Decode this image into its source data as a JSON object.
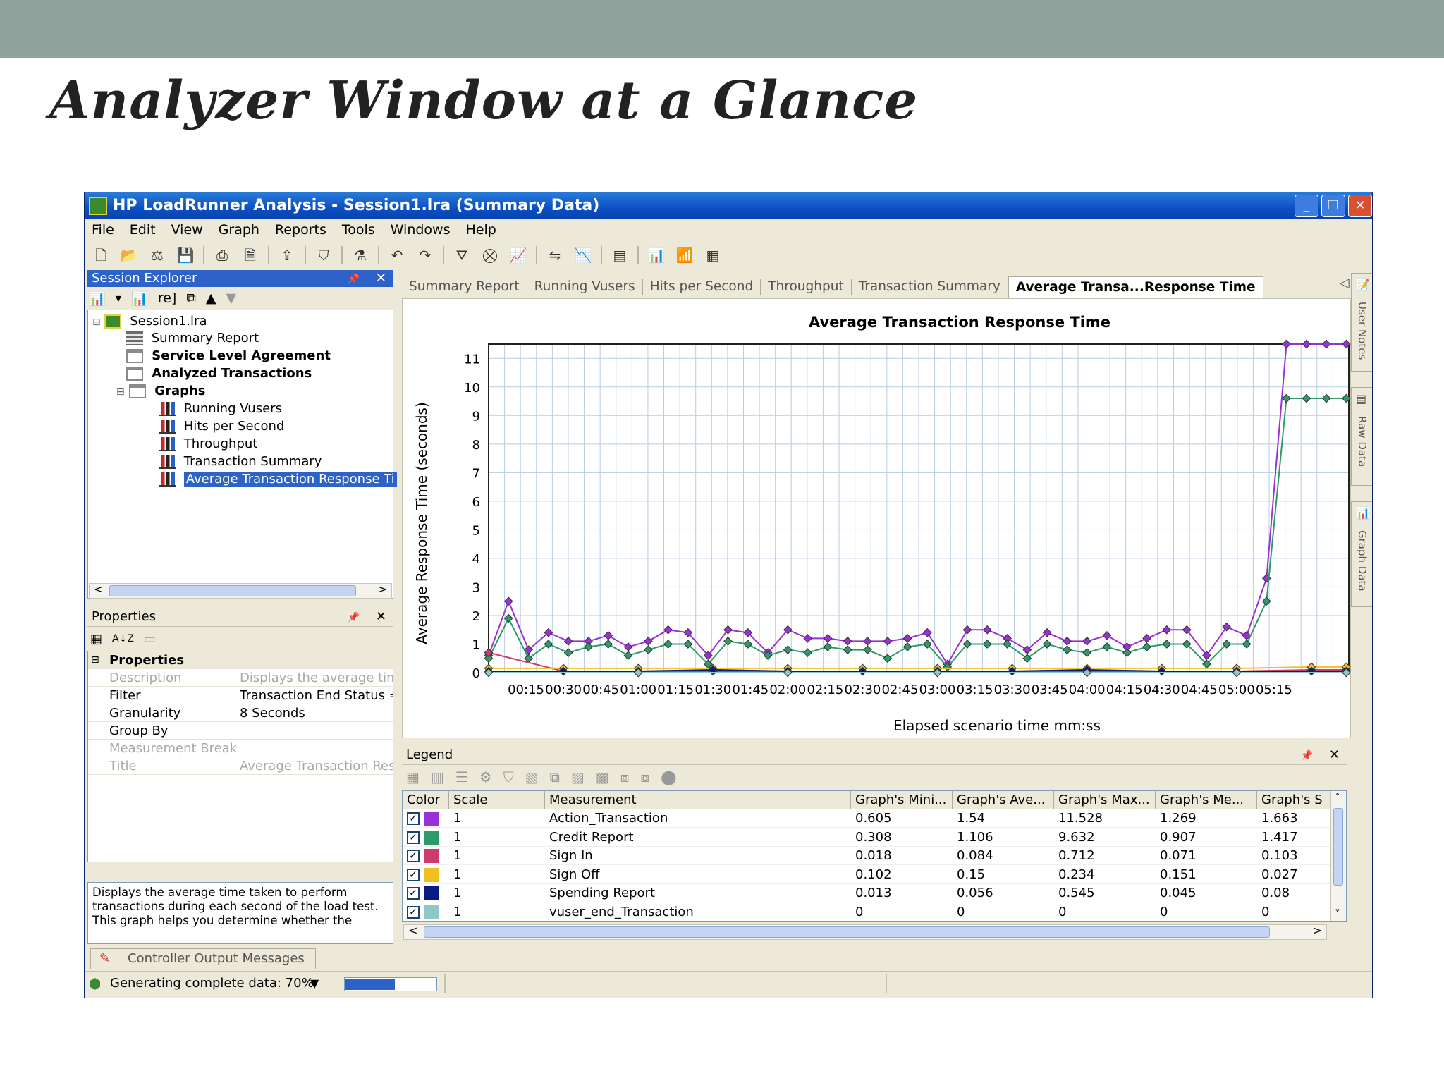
{
  "slide": {
    "title": "Analyzer Window at a Glance"
  },
  "window": {
    "title": "HP LoadRunner Analysis - Session1.lra (Summary Data)",
    "controls": {
      "minimize": "_",
      "restore": "❐",
      "close": "✕"
    }
  },
  "menu": [
    "File",
    "Edit",
    "View",
    "Graph",
    "Reports",
    "Tools",
    "Windows",
    "Help"
  ],
  "session_explorer": {
    "title": "Session Explorer",
    "toolbar_text": "re]",
    "tree": [
      {
        "label": "Session1.lra",
        "icon": "session-icon",
        "bold": false
      },
      {
        "label": "Summary Report",
        "icon": "report-icon",
        "bold": false
      },
      {
        "label": "Service Level Agreement",
        "icon": "folder-icon",
        "bold": true
      },
      {
        "label": "Analyzed Transactions",
        "icon": "folder-icon",
        "bold": true
      },
      {
        "label": "Graphs",
        "icon": "folder-icon",
        "bold": true
      },
      {
        "label": "Running Vusers",
        "icon": "graph-icon",
        "bold": false
      },
      {
        "label": "Hits per Second",
        "icon": "graph-icon",
        "bold": false
      },
      {
        "label": "Throughput",
        "icon": "graph-icon",
        "bold": false
      },
      {
        "label": "Transaction Summary",
        "icon": "graph-icon",
        "bold": false
      },
      {
        "label": "Average Transaction Response Ti",
        "icon": "graph-icon",
        "bold": false,
        "selected": true
      }
    ]
  },
  "properties": {
    "title": "Properties",
    "section": "Properties",
    "rows": [
      {
        "key": "Description",
        "value": "Displays the average time t",
        "dim": true
      },
      {
        "key": "Filter",
        "value": "Transaction End Status = (",
        "dim": false
      },
      {
        "key": "Granularity",
        "value": "8 Seconds",
        "dim": false
      },
      {
        "key": "Group By",
        "value": "",
        "dim": false
      },
      {
        "key": "Measurement Break",
        "value": "",
        "dim": true
      },
      {
        "key": "Title",
        "value": "Average Transaction Resp",
        "dim": true
      }
    ],
    "description_text": "Displays the average time taken to perform transactions during each second of the load test. This graph helps you determine whether the"
  },
  "tabs": [
    {
      "label": "Summary Report",
      "active": false
    },
    {
      "label": "Running Vusers",
      "active": false
    },
    {
      "label": "Hits per Second",
      "active": false
    },
    {
      "label": "Throughput",
      "active": false
    },
    {
      "label": "Transaction Summary",
      "active": false
    },
    {
      "label": "Average Transa...Response Time",
      "active": true
    }
  ],
  "right_tabs": [
    "User Notes",
    "Raw Data",
    "Graph Data"
  ],
  "chart_data": {
    "type": "line",
    "title": "Average Transaction Response Time",
    "xlabel": "Elapsed scenario time mm:ss",
    "ylabel": "Average Response Time (seconds)",
    "x_ticks": [
      "00:15",
      "00:30",
      "00:45",
      "01:00",
      "01:15",
      "01:30",
      "01:45",
      "02:00",
      "02:15",
      "02:30",
      "02:45",
      "03:00",
      "03:15",
      "03:30",
      "03:45",
      "04:00",
      "04:15",
      "04:30",
      "04:45",
      "05:00",
      "05:15"
    ],
    "y_ticks": [
      0,
      1,
      2,
      3,
      4,
      5,
      6,
      7,
      8,
      9,
      10,
      11
    ],
    "ylim": [
      0,
      11.5
    ],
    "xlim": [
      0,
      5.75
    ],
    "grid": true,
    "series": [
      {
        "name": "Action_Transaction",
        "color": "#9b30d8",
        "x": [
          0.0,
          0.133,
          0.267,
          0.4,
          0.533,
          0.667,
          0.8,
          0.933,
          1.067,
          1.2,
          1.333,
          1.467,
          1.6,
          1.733,
          1.867,
          2.0,
          2.133,
          2.267,
          2.4,
          2.533,
          2.667,
          2.8,
          2.933,
          3.067,
          3.2,
          3.333,
          3.467,
          3.6,
          3.733,
          3.867,
          4.0,
          4.133,
          4.267,
          4.4,
          4.533,
          4.667,
          4.8,
          4.933,
          5.067,
          5.2,
          5.333,
          5.467,
          5.6,
          5.733
        ],
        "y": [
          0.6,
          2.5,
          0.8,
          1.4,
          1.1,
          1.1,
          1.3,
          0.9,
          1.1,
          1.5,
          1.4,
          0.6,
          1.5,
          1.4,
          0.7,
          1.5,
          1.2,
          1.2,
          1.1,
          1.1,
          1.1,
          1.2,
          1.4,
          0.3,
          1.5,
          1.5,
          1.2,
          0.8,
          1.4,
          1.1,
          1.1,
          1.3,
          0.9,
          1.2,
          1.5,
          1.5,
          0.6,
          1.6,
          1.3,
          3.3,
          11.5,
          11.5,
          11.5,
          11.5
        ]
      },
      {
        "name": "Credit Report",
        "color": "#2e9a6a",
        "x": [
          0.0,
          0.133,
          0.267,
          0.4,
          0.533,
          0.667,
          0.8,
          0.933,
          1.067,
          1.2,
          1.333,
          1.467,
          1.6,
          1.733,
          1.867,
          2.0,
          2.133,
          2.267,
          2.4,
          2.533,
          2.667,
          2.8,
          2.933,
          3.067,
          3.2,
          3.333,
          3.467,
          3.6,
          3.733,
          3.867,
          4.0,
          4.133,
          4.267,
          4.4,
          4.533,
          4.667,
          4.8,
          4.933,
          5.067,
          5.2,
          5.333,
          5.467,
          5.6,
          5.733
        ],
        "y": [
          0.5,
          1.9,
          0.5,
          1.0,
          0.7,
          0.9,
          1.0,
          0.6,
          0.8,
          1.0,
          1.0,
          0.3,
          1.1,
          1.0,
          0.6,
          0.8,
          0.7,
          0.9,
          0.8,
          0.8,
          0.5,
          0.9,
          1.0,
          0.2,
          1.0,
          1.0,
          1.0,
          0.5,
          1.0,
          0.8,
          0.7,
          0.9,
          0.7,
          0.9,
          1.0,
          1.0,
          0.3,
          1.0,
          1.0,
          2.5,
          9.6,
          9.6,
          9.6,
          9.6
        ]
      },
      {
        "name": "Sign In",
        "color": "#d03a6a",
        "x": [
          0.0,
          0.5,
          1.0,
          1.5,
          2.0,
          2.5,
          3.0,
          3.5,
          4.0,
          4.5,
          5.0,
          5.5,
          5.733
        ],
        "y": [
          0.7,
          0.05,
          0.05,
          0.05,
          0.05,
          0.05,
          0.05,
          0.05,
          0.05,
          0.05,
          0.05,
          0.1,
          0.1
        ]
      },
      {
        "name": "Sign Off",
        "color": "#f0c020",
        "x": [
          0.0,
          0.5,
          1.0,
          1.5,
          2.0,
          2.5,
          3.0,
          3.5,
          4.0,
          4.5,
          5.0,
          5.5,
          5.733
        ],
        "y": [
          0.15,
          0.15,
          0.15,
          0.15,
          0.15,
          0.15,
          0.15,
          0.15,
          0.15,
          0.15,
          0.15,
          0.2,
          0.2
        ]
      },
      {
        "name": "Spending Report",
        "color": "#0a1a80",
        "x": [
          0.0,
          0.5,
          1.0,
          1.5,
          2.0,
          2.5,
          3.0,
          3.5,
          4.0,
          4.5,
          5.0,
          5.5,
          5.733
        ],
        "y": [
          0.05,
          0.05,
          0.05,
          0.1,
          0.05,
          0.05,
          0.05,
          0.05,
          0.1,
          0.05,
          0.05,
          0.05,
          0.05
        ]
      },
      {
        "name": "vuser_end_Transaction",
        "color": "#8ec8c8",
        "x": [
          0.0,
          1.0,
          2.0,
          3.0,
          4.0,
          5.0,
          5.733
        ],
        "y": [
          0,
          0,
          0,
          0,
          0,
          0,
          0
        ]
      }
    ]
  },
  "legend": {
    "title": "Legend",
    "columns": [
      "Color",
      "Scale",
      "Measurement",
      "Graph's Mini...",
      "Graph's Ave...",
      "Graph's Max...",
      "Graph's Me...",
      "Graph's S"
    ],
    "rows": [
      {
        "color": "#9b30d8",
        "scale": "1",
        "measurement": "Action_Transaction",
        "min": "0.605",
        "avg": "1.54",
        "max": "11.528",
        "median": "1.269",
        "std": "1.663"
      },
      {
        "color": "#2e9a6a",
        "scale": "1",
        "measurement": "Credit Report",
        "min": "0.308",
        "avg": "1.106",
        "max": "9.632",
        "median": "0.907",
        "std": "1.417"
      },
      {
        "color": "#d03a6a",
        "scale": "1",
        "measurement": "Sign In",
        "min": "0.018",
        "avg": "0.084",
        "max": "0.712",
        "median": "0.071",
        "std": "0.103"
      },
      {
        "color": "#f0c020",
        "scale": "1",
        "measurement": "Sign Off",
        "min": "0.102",
        "avg": "0.15",
        "max": "0.234",
        "median": "0.151",
        "std": "0.027"
      },
      {
        "color": "#0a1a80",
        "scale": "1",
        "measurement": "Spending Report",
        "min": "0.013",
        "avg": "0.056",
        "max": "0.545",
        "median": "0.045",
        "std": "0.08"
      },
      {
        "color": "#8ec8c8",
        "scale": "1",
        "measurement": "vuser_end_Transaction",
        "min": "0",
        "avg": "0",
        "max": "0",
        "median": "0",
        "std": "0"
      }
    ]
  },
  "bottom_tab": "Controller Output Messages",
  "status": {
    "text": "Generating complete data: 70%",
    "progress": 0.55
  },
  "icons": {
    "pin": "📌",
    "close": "✕",
    "scroll_left": "<",
    "scroll_right": ">",
    "scroll_up": "˄",
    "scroll_down": "˅",
    "dropdown": "▼",
    "tab_prev": "◁",
    "tab_next": "▷",
    "tree_collapse": "⊟",
    "section_collapse": "⊟",
    "up_arrow": "▲",
    "down_arrow": "▼",
    "sort": "A↓Z",
    "check": "✓"
  }
}
